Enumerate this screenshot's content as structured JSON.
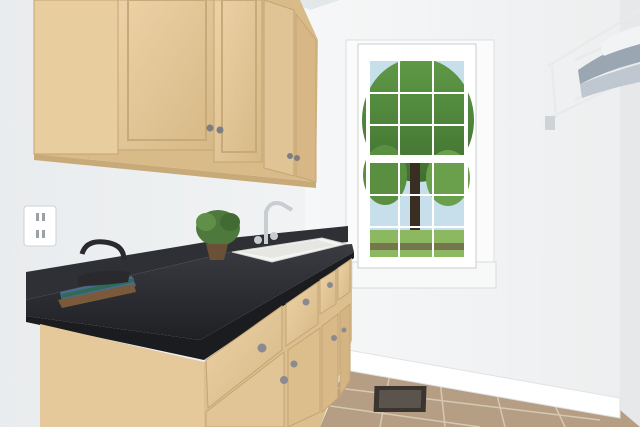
{
  "scene": {
    "kind": "photo",
    "subject": "laundry-room",
    "colors": {
      "wall_left": "#eceff0",
      "wall_right": "#f4f5f6",
      "ceiling": "#e7eaec",
      "cabinet": "#e2c79b",
      "cabinet_shadow": "#c9a877",
      "countertop": "#2b2d31",
      "floor_tile": "#b9a389",
      "trim": "#ffffff",
      "tree_green": "#4f8a3a",
      "sky": "#cfe4ef"
    }
  }
}
